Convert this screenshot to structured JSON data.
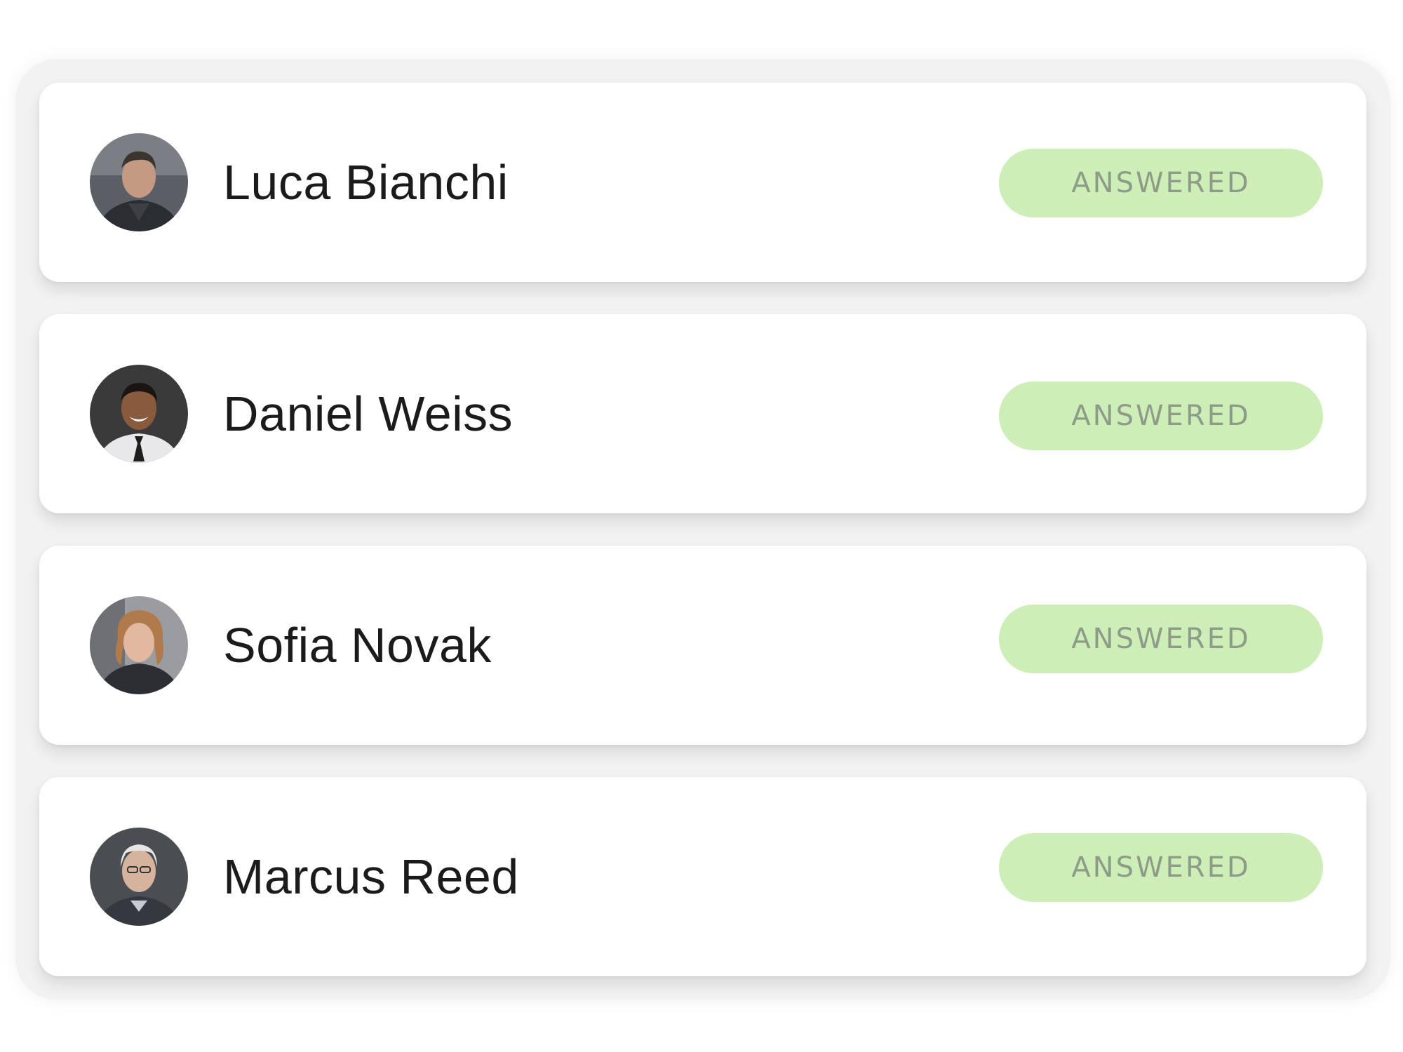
{
  "theme": {
    "badge_bg": "#cdefb7",
    "badge_text": "#8e9b88",
    "card_bg": "#ffffff",
    "name_color": "#1b1b1b"
  },
  "rows": [
    {
      "name": "Luca Bianchi",
      "status": "ANSWERED"
    },
    {
      "name": "Daniel Weiss",
      "status": "ANSWERED"
    },
    {
      "name": "Sofia Novak",
      "status": "ANSWERED"
    },
    {
      "name": "Marcus Reed",
      "status": "ANSWERED"
    }
  ]
}
